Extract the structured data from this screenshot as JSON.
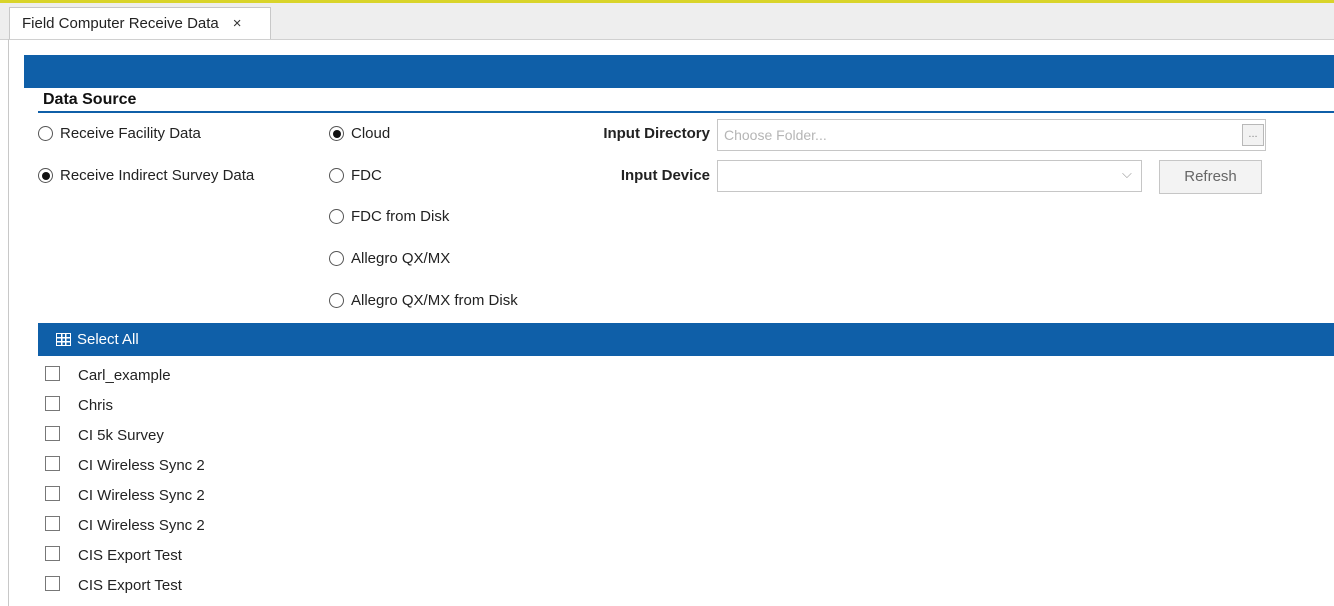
{
  "tab": {
    "title": "Field Computer Receive Data",
    "close": "×"
  },
  "section": {
    "title": "Data Source"
  },
  "receive_type": [
    {
      "label": "Receive Facility Data",
      "selected": false
    },
    {
      "label": "Receive Indirect Survey Data",
      "selected": true
    }
  ],
  "source": [
    {
      "label": "Cloud",
      "selected": true
    },
    {
      "label": "FDC",
      "selected": false
    },
    {
      "label": "FDC from Disk",
      "selected": false
    },
    {
      "label": "Allegro QX/MX",
      "selected": false
    },
    {
      "label": "Allegro QX/MX from Disk",
      "selected": false
    }
  ],
  "input_directory": {
    "label": "Input Directory",
    "placeholder": "Choose Folder...",
    "browse": "..."
  },
  "input_device": {
    "label": "Input Device",
    "value": "",
    "chevron": "⌵"
  },
  "refresh_label": "Refresh",
  "select_all_label": "Select All",
  "items": [
    {
      "label": "Carl_example",
      "checked": false
    },
    {
      "label": "Chris",
      "checked": false
    },
    {
      "label": "CI 5k Survey",
      "checked": false
    },
    {
      "label": "CI Wireless Sync 2",
      "checked": false
    },
    {
      "label": "CI Wireless Sync 2",
      "checked": false
    },
    {
      "label": "CI Wireless Sync 2",
      "checked": false
    },
    {
      "label": "CIS Export Test",
      "checked": false
    },
    {
      "label": "CIS Export Test",
      "checked": false
    }
  ],
  "colors": {
    "accent_blue": "#0f5fa8",
    "top_accent": "#d9d42a"
  }
}
